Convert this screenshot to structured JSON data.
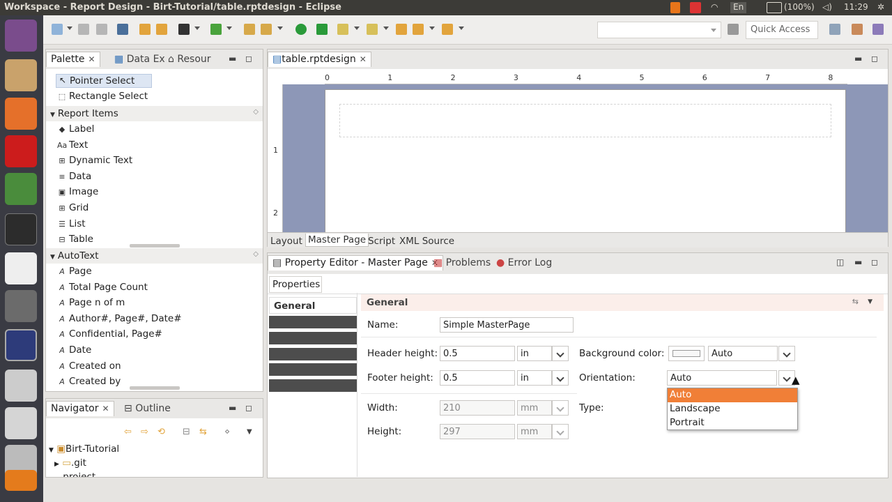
{
  "window_title": "Workspace - Report Design - Birt-Tutorial/table.rptdesign - Eclipse",
  "topbar": {
    "keyboard": "En",
    "battery": "(100%)",
    "time": "11:29"
  },
  "toolbar": {
    "quick_access": "Quick Access"
  },
  "palette": {
    "tabs": [
      "Palette",
      "Data Ex",
      "Resour"
    ],
    "tools": [
      "Pointer Select",
      "Rectangle Select"
    ],
    "report_items_label": "Report Items",
    "report_items": [
      {
        "icon": "tag-icon",
        "glyph": "◆",
        "label": "Label"
      },
      {
        "icon": "text-icon",
        "glyph": "Aa",
        "label": "Text"
      },
      {
        "icon": "dynamic-text-icon",
        "glyph": "⊞",
        "label": "Dynamic Text"
      },
      {
        "icon": "database-icon",
        "glyph": "≡",
        "label": "Data"
      },
      {
        "icon": "image-icon",
        "glyph": "▣",
        "label": "Image"
      },
      {
        "icon": "grid-icon",
        "glyph": "⊞",
        "label": "Grid"
      },
      {
        "icon": "list-icon",
        "glyph": "☰",
        "label": "List"
      },
      {
        "icon": "table-icon",
        "glyph": "⊟",
        "label": "Table"
      }
    ],
    "autotext_label": "AutoText",
    "autotext_items": [
      "Page",
      "Total Page Count",
      "Page n of m",
      "Author#, Page#, Date#",
      "Confidential, Page#",
      "Date",
      "Created on",
      "Created by"
    ]
  },
  "navigator": {
    "tabs": [
      "Navigator",
      "Outline"
    ],
    "tree": [
      "Birt-Tutorial",
      ".git",
      ".project"
    ]
  },
  "editor": {
    "tab": "table.rptdesign",
    "ruler": [
      "0",
      "1",
      "2",
      "3",
      "4",
      "5",
      "6",
      "7",
      "8"
    ],
    "vruler": [
      "1",
      "2"
    ],
    "subtabs": [
      "Layout",
      "Master Page",
      "Script",
      "XML Source"
    ]
  },
  "property_editor": {
    "tabs": [
      "Property Editor - Master Page",
      "Problems",
      "Error Log"
    ],
    "properties_tab": "Properties",
    "section": "General",
    "side_nav_label": "General",
    "name_label": "Name:",
    "name_value": "Simple MasterPage",
    "header_height_label": "Header height:",
    "header_height_value": "0.5",
    "header_unit": "in",
    "footer_height_label": "Footer height:",
    "footer_height_value": "0.5",
    "footer_unit": "in",
    "width_label": "Width:",
    "width_value": "210",
    "width_unit": "mm",
    "height_label": "Height:",
    "height_value": "297",
    "height_unit": "mm",
    "bg_color_label": "Background color:",
    "bg_color_value": "Auto",
    "orientation_label": "Orientation:",
    "orientation_value": "Auto",
    "type_label": "Type:",
    "orientation_options": [
      "Auto",
      "Landscape",
      "Portrait"
    ]
  }
}
